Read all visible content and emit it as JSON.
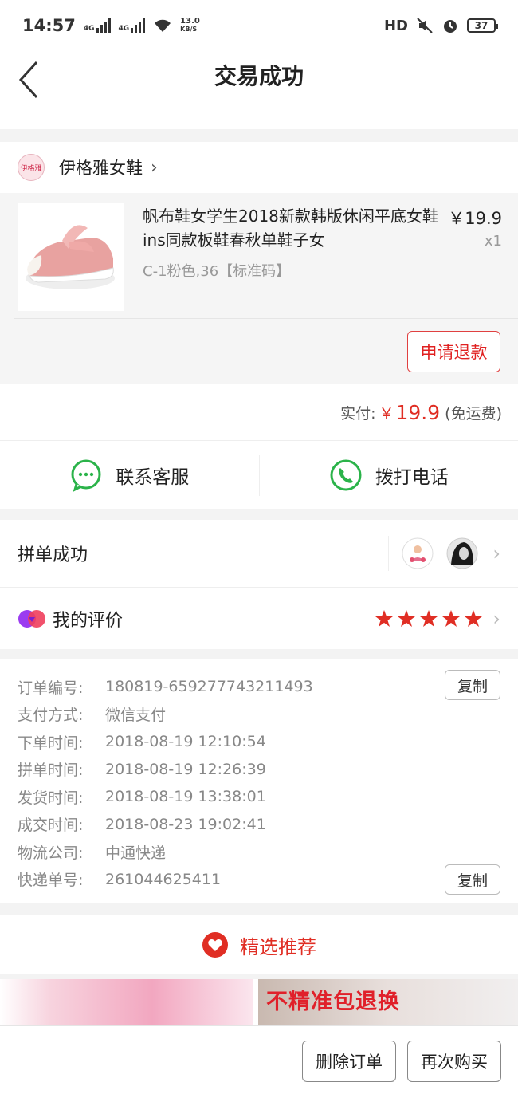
{
  "status_bar": {
    "time": "14:57",
    "net1": "4G",
    "net2": "4G",
    "speed_value": "13.0",
    "speed_unit": "KB/S",
    "hd": "HD",
    "battery": "37"
  },
  "header": {
    "title": "交易成功"
  },
  "store": {
    "name": "伊格雅女鞋",
    "logo_text": "伊格雅"
  },
  "product": {
    "name": "帆布鞋女学生2018新款韩版休闲平底女鞋ins同款板鞋春秋单鞋子女",
    "spec": "C-1粉色,36【标准码】",
    "price": "￥19.9",
    "qty": "x1",
    "refund_label": "申请退款"
  },
  "payment": {
    "label": "实付:",
    "currency": "￥",
    "amount": "19.9",
    "note": "(免运费)"
  },
  "contact": {
    "service_label": "联系客服",
    "call_label": "拨打电话"
  },
  "group": {
    "label": "拼单成功"
  },
  "review": {
    "label": "我的评价",
    "rating": 5
  },
  "order_info": {
    "rows": [
      {
        "key": "订单编号:",
        "value": "180819-659277743211493"
      },
      {
        "key": "支付方式:",
        "value": "微信支付"
      },
      {
        "key": "下单时间:",
        "value": "2018-08-19 12:10:54"
      },
      {
        "key": "拼单时间:",
        "value": "2018-08-19 12:26:39"
      },
      {
        "key": "发货时间:",
        "value": "2018-08-19 13:38:01"
      },
      {
        "key": "成交时间:",
        "value": "2018-08-23 19:02:41"
      },
      {
        "key": "物流公司:",
        "value": "中通快递"
      },
      {
        "key": "快递单号:",
        "value": "261044625411"
      }
    ],
    "copy_label": "复制"
  },
  "recommend": {
    "title": "精选推荐"
  },
  "banner": {
    "right_text": "不精准包退换"
  },
  "bottom": {
    "delete_label": "删除订单",
    "rebuy_label": "再次购买"
  },
  "colors": {
    "accent": "#e02e24",
    "wechat_green": "#2bb34a"
  }
}
